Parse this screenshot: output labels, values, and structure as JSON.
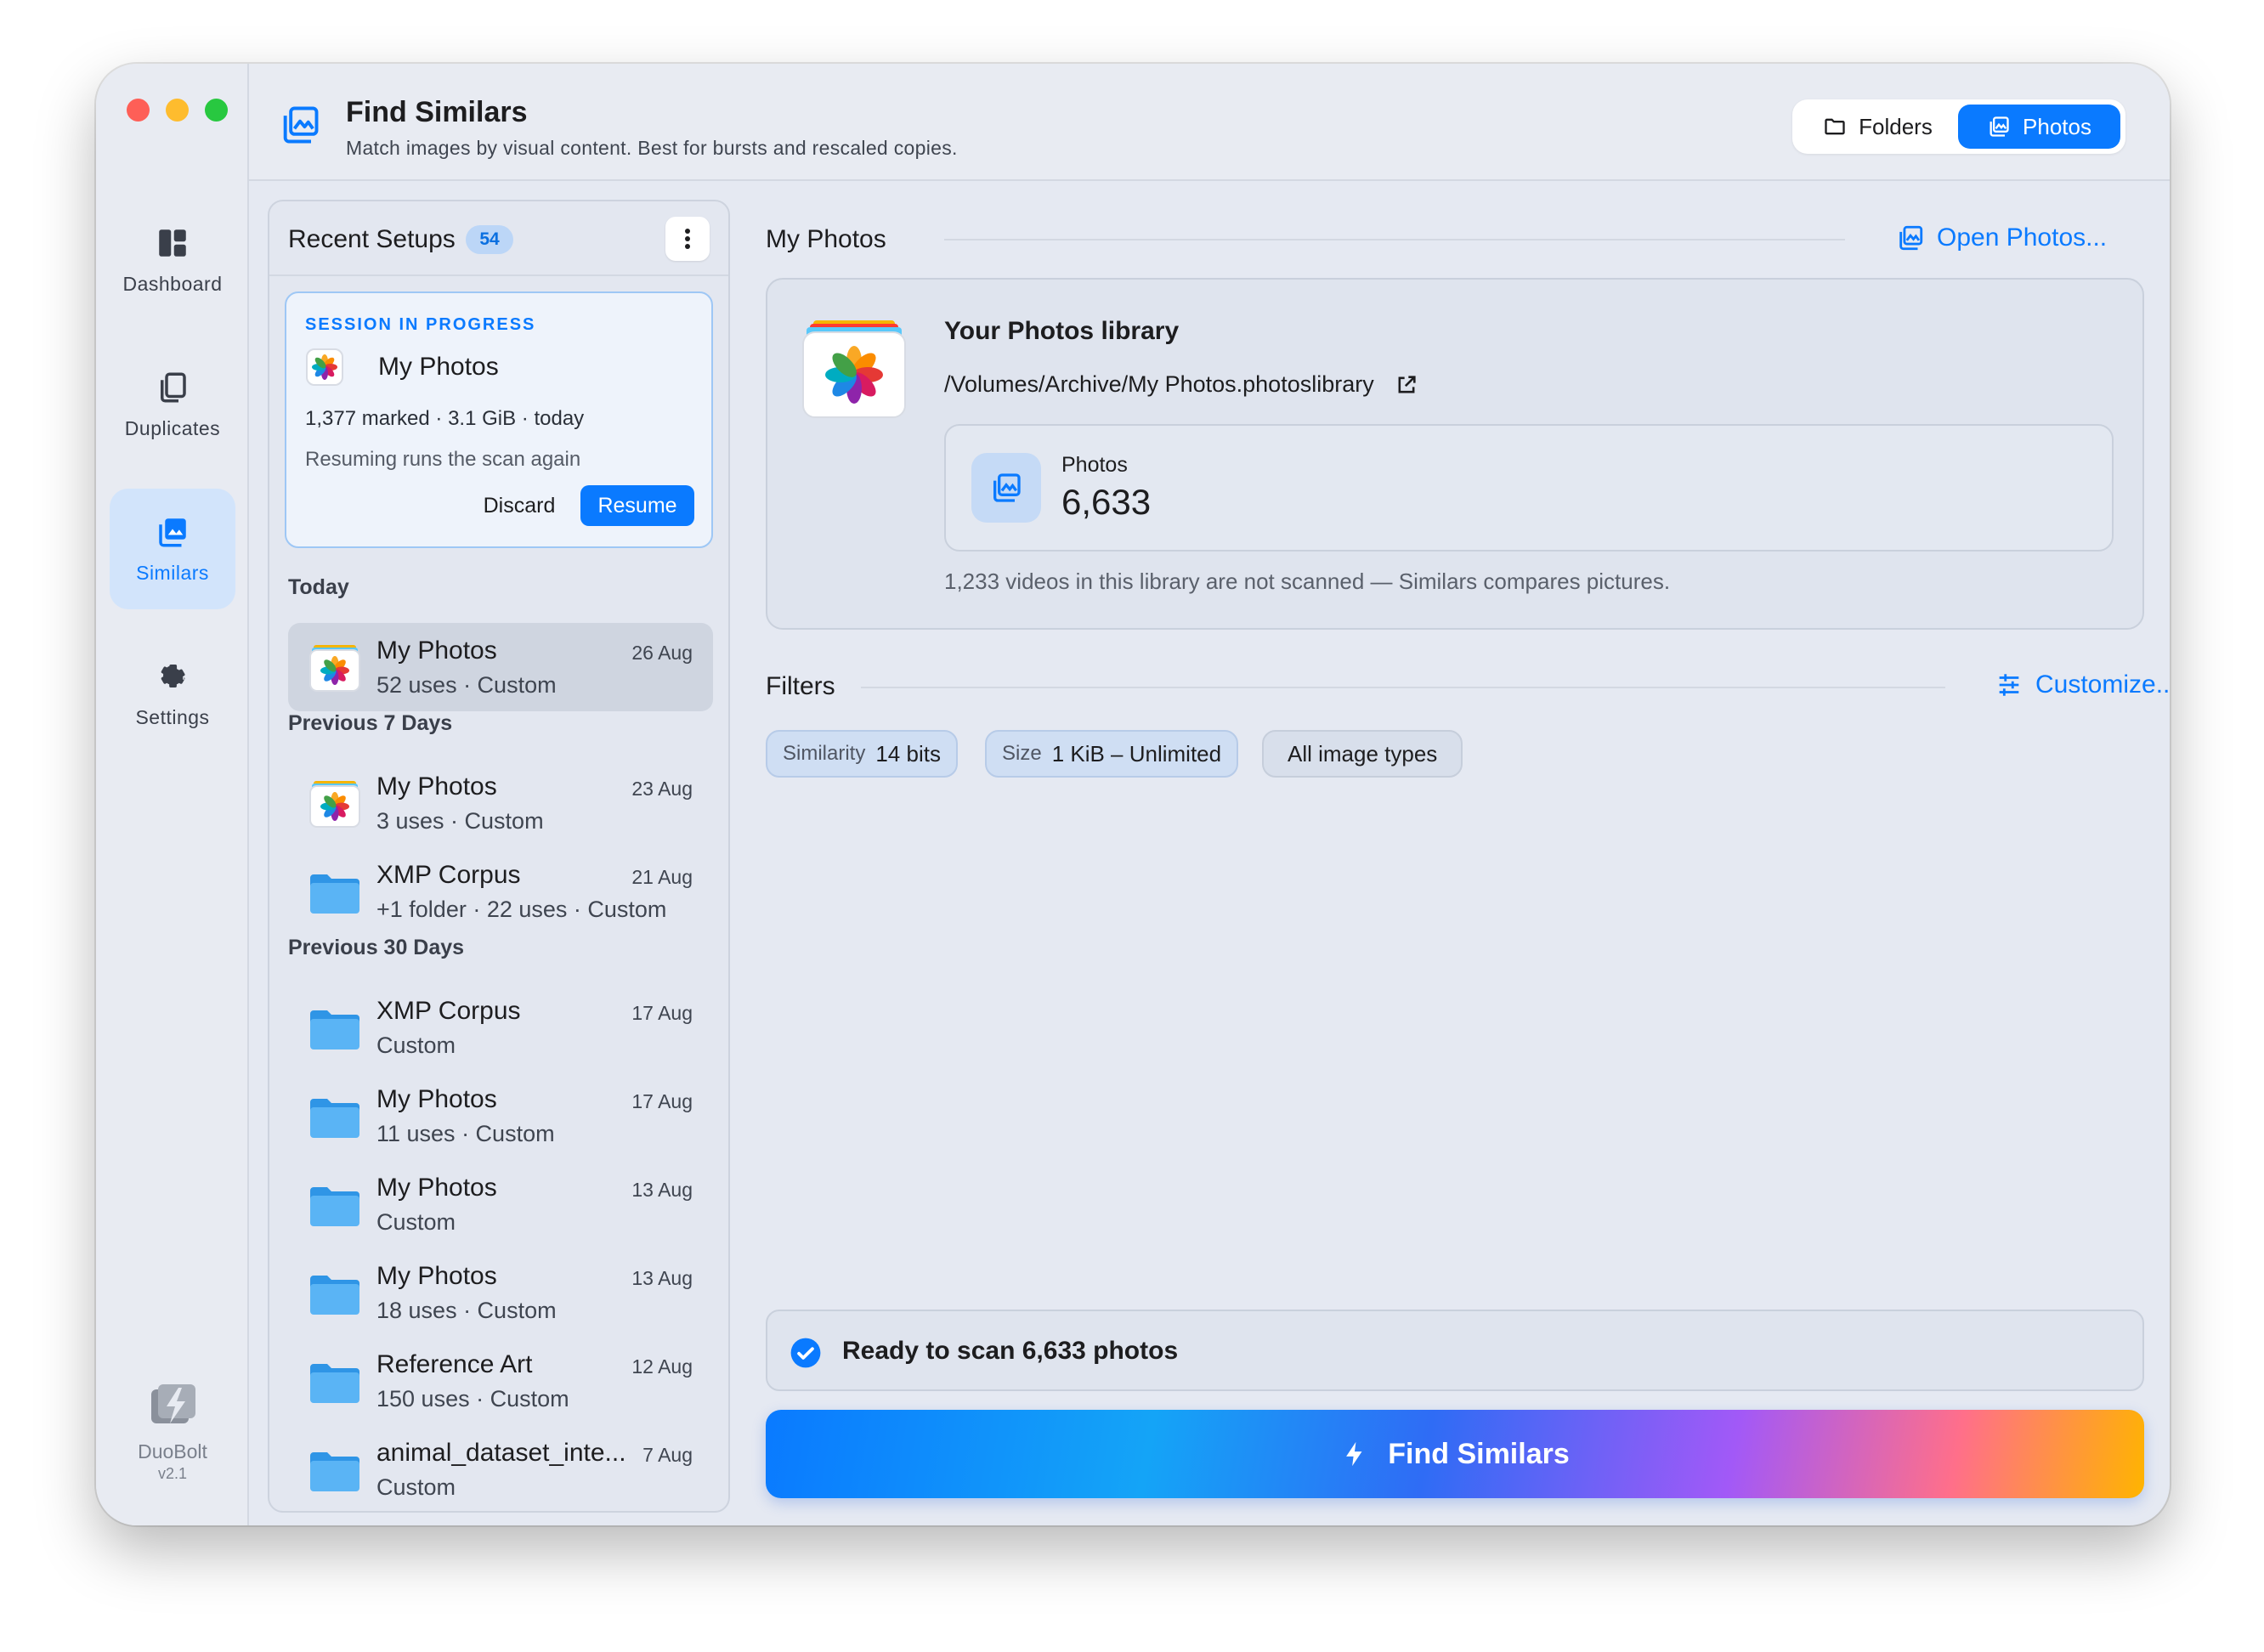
{
  "sidebar": {
    "items": [
      {
        "label": "Dashboard",
        "icon": "dashboard-icon"
      },
      {
        "label": "Duplicates",
        "icon": "duplicates-icon"
      },
      {
        "label": "Similars",
        "icon": "similars-icon",
        "active": true
      },
      {
        "label": "Settings",
        "icon": "gear-icon"
      }
    ],
    "brand": {
      "name": "DuoBolt",
      "version": "v2.1"
    }
  },
  "header": {
    "title": "Find Similars",
    "subtitle": "Match images by visual content. Best for bursts and rescaled copies.",
    "segments": [
      {
        "label": "Folders",
        "icon": "folder-icon",
        "selected": false
      },
      {
        "label": "Photos",
        "icon": "photos-icon",
        "selected": true
      }
    ]
  },
  "recent": {
    "title": "Recent Setups",
    "count": "54",
    "session": {
      "tag": "SESSION IN PROGRESS",
      "name": "My Photos",
      "meta": "1,377 marked · 3.1 GiB · today",
      "note": "Resuming runs the scan again",
      "discard": "Discard",
      "resume": "Resume"
    },
    "sections": {
      "today": "Today",
      "prev7": "Previous 7 Days",
      "prev30": "Previous 30 Days"
    },
    "rows": [
      {
        "name": "My Photos",
        "meta": "52 uses · Custom",
        "date": "26 Aug",
        "kind": "photos"
      },
      {
        "name": "My Photos",
        "meta": "3 uses · Custom",
        "date": "23 Aug",
        "kind": "photos"
      },
      {
        "name": "XMP Corpus",
        "meta": "+1 folder · 22 uses · Custom",
        "date": "21 Aug",
        "kind": "folder"
      },
      {
        "name": "XMP Corpus",
        "meta": "Custom",
        "date": "17 Aug",
        "kind": "folder"
      },
      {
        "name": "My Photos",
        "meta": "11 uses · Custom",
        "date": "17 Aug",
        "kind": "folder"
      },
      {
        "name": "My Photos",
        "meta": "Custom",
        "date": "13 Aug",
        "kind": "folder"
      },
      {
        "name": "My Photos",
        "meta": "18 uses · Custom",
        "date": "13 Aug",
        "kind": "folder"
      },
      {
        "name": "Reference Art",
        "meta": "150 uses · Custom",
        "date": "12 Aug",
        "kind": "folder"
      },
      {
        "name": "animal_dataset_inte...",
        "meta": "Custom",
        "date": "7 Aug",
        "kind": "folder"
      }
    ]
  },
  "library": {
    "section_title": "My Photos",
    "open_label": "Open Photos...",
    "card_title": "Your Photos library",
    "path": "/Volumes/Archive/My Photos.photoslibrary",
    "stat_label": "Photos",
    "stat_value": "6,633",
    "note": "1,233 videos in this library are not scanned — Similars compares pictures."
  },
  "filters": {
    "title": "Filters",
    "customize_label": "Customize...",
    "chips": [
      {
        "key": "Similarity",
        "value": "14 bits"
      },
      {
        "key": "Size",
        "value": "1 KiB – Unlimited"
      },
      {
        "key": "",
        "value": "All image types"
      }
    ]
  },
  "status": {
    "text": "Ready to scan 6,633 photos"
  },
  "cta": {
    "label": "Find Similars"
  },
  "colors": {
    "accent": "#0a7aff",
    "window_bg": "#e5e9f2"
  }
}
